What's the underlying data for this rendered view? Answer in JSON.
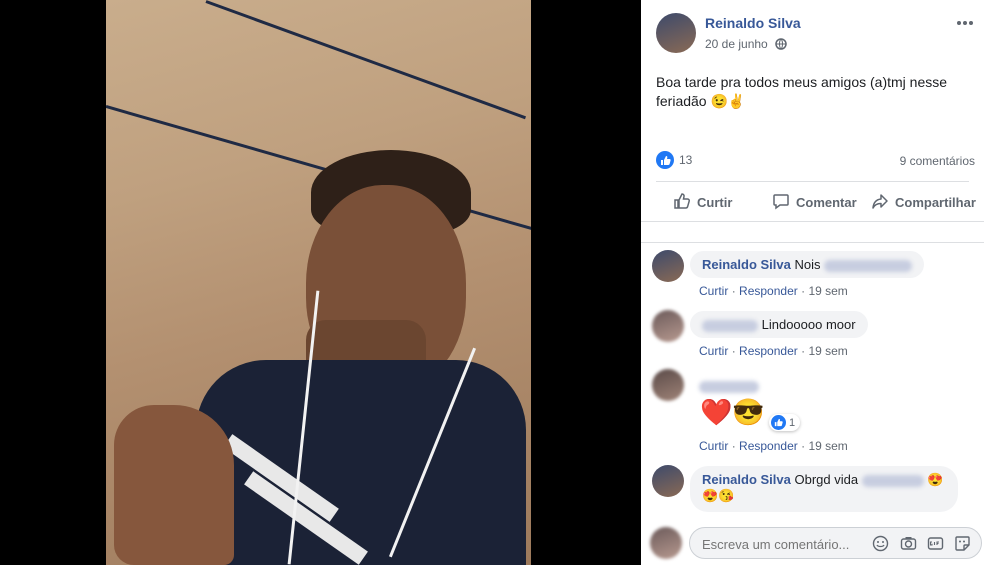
{
  "post": {
    "author": "Reinaldo Silva",
    "date": "20 de junho",
    "text_line1": "Boa tarde pra todos meus amigos (a)tmj nesse",
    "text_line2": "feriadão 😉✌️",
    "likes": "13",
    "comments_count": "9 comentários"
  },
  "actions": {
    "like": "Curtir",
    "comment": "Comentar",
    "share": "Compartilhar"
  },
  "comments": [
    {
      "author": "Reinaldo Silva",
      "text": "Nois",
      "like": "Curtir",
      "reply": "Responder",
      "time": "19 sem"
    },
    {
      "author": "",
      "text": "Lindooooo moor",
      "like": "Curtir",
      "reply": "Responder",
      "time": "19 sem"
    },
    {
      "author": "",
      "text": "❤️😎",
      "reactions": "1",
      "like": "Curtir",
      "reply": "Responder",
      "time": "19 sem"
    },
    {
      "author": "Reinaldo Silva",
      "text": "Obrgd vida",
      "text_line2": "😍😘",
      "like": "Curtir",
      "reply": "Responder",
      "time": "19 sem"
    }
  ],
  "composer": {
    "placeholder": "Escreva um comentário..."
  },
  "icons": {
    "more": "more-icon",
    "globe": "globe-icon",
    "like": "thumbs-up-icon",
    "comment": "comment-icon",
    "share": "share-icon",
    "emoji": "emoji-icon",
    "camera": "camera-icon",
    "gif": "gif-icon",
    "sticker": "sticker-icon"
  },
  "colors": {
    "link": "#385898",
    "like_blue": "#2078f4"
  }
}
